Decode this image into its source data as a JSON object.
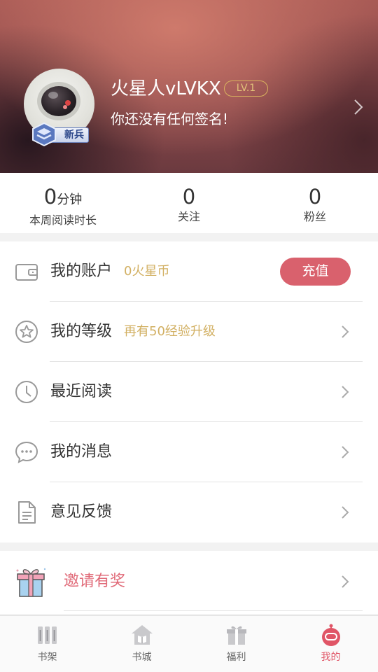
{
  "profile": {
    "username": "火星人vLVKX",
    "level": "LV.1",
    "signature": "你还没有任何签名!",
    "rank_badge": "新兵"
  },
  "stats": [
    {
      "value": "0",
      "unit": "分钟",
      "label": "本周阅读时长"
    },
    {
      "value": "0",
      "unit": "",
      "label": "关注"
    },
    {
      "value": "0",
      "unit": "",
      "label": "粉丝"
    }
  ],
  "menu": {
    "account": {
      "title": "我的账户",
      "extra": "0火星币",
      "button": "充值"
    },
    "level": {
      "title": "我的等级",
      "extra": "再有50经验升级"
    },
    "recent": {
      "title": "最近阅读"
    },
    "messages": {
      "title": "我的消息"
    },
    "feedback": {
      "title": "意见反馈"
    }
  },
  "invite": {
    "title": "邀请有奖"
  },
  "tabs": [
    {
      "label": "书架",
      "icon": "bookshelf-icon",
      "active": false
    },
    {
      "label": "书城",
      "icon": "bookstore-icon",
      "active": false
    },
    {
      "label": "福利",
      "icon": "gift-icon",
      "active": false
    },
    {
      "label": "我的",
      "icon": "robot-icon",
      "active": true
    }
  ],
  "colors": {
    "accent": "#d9616d",
    "gold": "#d2b063",
    "invite_text": "#e06a78",
    "active_tab": "#e05566"
  }
}
